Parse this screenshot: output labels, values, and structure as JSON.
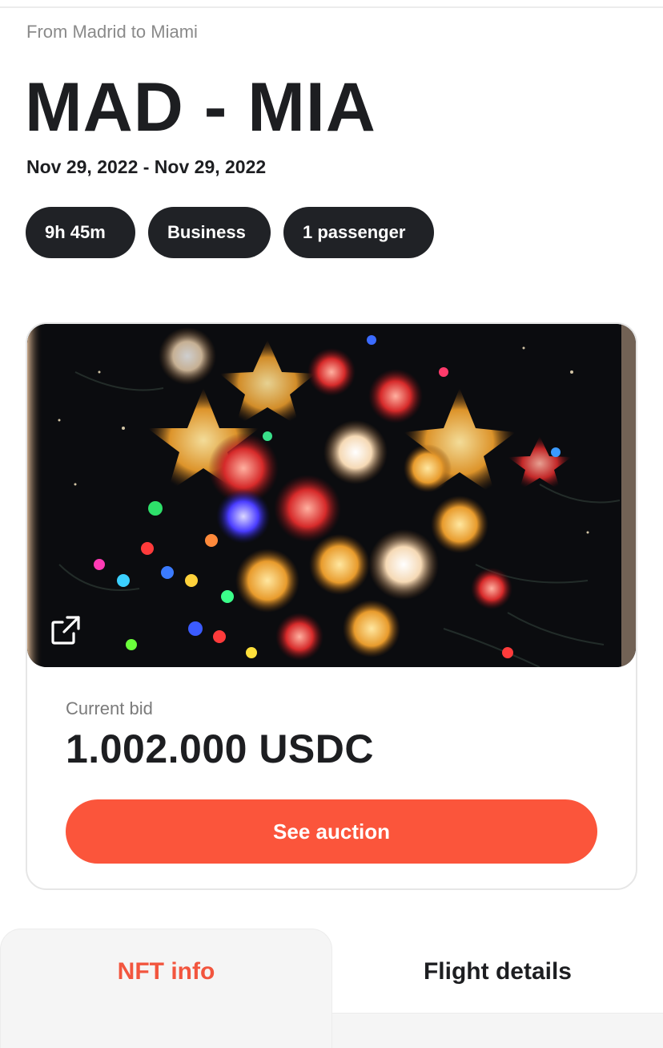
{
  "header": {
    "subtitle": "From Madrid to Miami",
    "route": "MAD - MIA",
    "dates": "Nov 29, 2022 - Nov 29, 2022"
  },
  "chips": {
    "duration": "9h 45m",
    "cabin": "Business",
    "passengers": "1 passenger"
  },
  "nft_card": {
    "image_description": "colorful fireworks artwork",
    "open_icon": "external-link-icon",
    "bid_label": "Current bid",
    "bid_value": "1.002.000 USDC",
    "cta_label": "See auction"
  },
  "tabs": {
    "active": "NFT info",
    "inactive": "Flight details"
  },
  "colors": {
    "accent": "#fb553b",
    "chip_bg": "#202226",
    "text": "#1d1e21",
    "muted": "#8a8a8a"
  }
}
